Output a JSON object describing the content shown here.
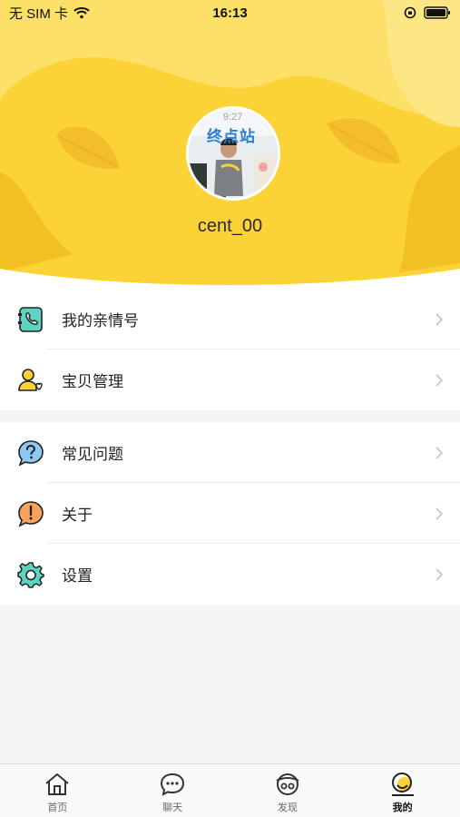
{
  "status_bar": {
    "carrier": "无 SIM 卡",
    "time": "16:13"
  },
  "profile": {
    "username": "cent_00",
    "avatar_caption": "终点站",
    "avatar_time": "9:27"
  },
  "menu": {
    "group1": [
      {
        "label": "我的亲情号",
        "icon": "phone-book-icon"
      },
      {
        "label": "宝贝管理",
        "icon": "child-profile-icon"
      }
    ],
    "group2": [
      {
        "label": "常见问题",
        "icon": "question-icon"
      },
      {
        "label": "关于",
        "icon": "exclamation-icon"
      },
      {
        "label": "设置",
        "icon": "gear-icon"
      }
    ]
  },
  "tabbar": {
    "tabs": [
      {
        "label": "首页",
        "icon": "home-icon",
        "active": false
      },
      {
        "label": "聊天",
        "icon": "chat-icon",
        "active": false
      },
      {
        "label": "发现",
        "icon": "discover-icon",
        "active": false
      },
      {
        "label": "我的",
        "icon": "profile-icon",
        "active": true
      }
    ]
  },
  "colors": {
    "accent_yellow": "#fcd336",
    "dark_yellow": "#f2c023",
    "teal": "#5dd3c3",
    "blue": "#8ec8f5",
    "orange": "#f7a35c"
  }
}
